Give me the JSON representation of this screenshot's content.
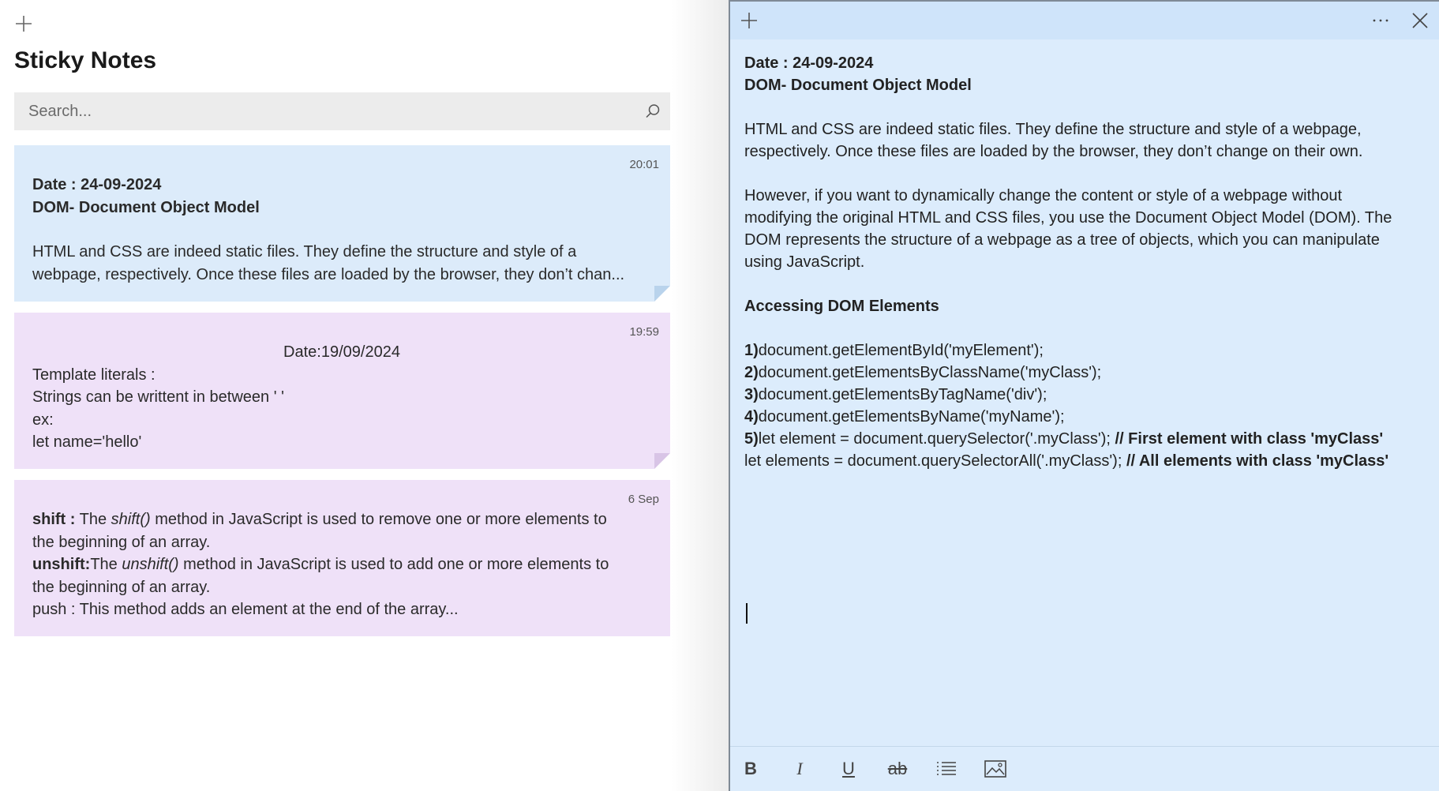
{
  "list": {
    "title": "Sticky Notes",
    "search_placeholder": "Search...",
    "notes": [
      {
        "time": "20:01",
        "line1": "Date : 24-09-2024",
        "line2": "DOM- Document Object Model",
        "line3": "HTML and CSS are indeed static files. They define the structure and style of a",
        "line4": "webpage, respectively. Once these files are loaded by the browser, they don’t chan..."
      },
      {
        "time": "19:59",
        "line1": "Date:19/09/2024",
        "line2": "Template literals :",
        "line3": "Strings can be writtent in between ' '",
        "line4": "ex:",
        "line5": "let name='hello'"
      },
      {
        "time": "6 Sep",
        "l1_bold": "shift :",
        "l1_a": " The ",
        "l1_italic": "shift()",
        "l1_b": " method in JavaScript is used to remove one or more elements to",
        "line2": "the beginning of an array.",
        "l3_bold": "unshift:",
        "l3_a": "The ",
        "l3_italic": "unshift()",
        "l3_b": " method in JavaScript is used to add one or more elements to",
        "line4": "the beginning of an array.",
        "line5": "push : This method adds an element at the end of the array..."
      }
    ]
  },
  "editor": {
    "heading1": "Date : 24-09-2024",
    "heading2": "DOM- Document Object Model",
    "para1_l1": "HTML and CSS are indeed static files. They define the structure and style of a webpage,",
    "para1_l2": "respectively. Once these files are loaded by the browser, they don’t change on their own.",
    "para2_l1": "However, if you want to dynamically change the content or style of a webpage without",
    "para2_l2": "modifying the original HTML and CSS files, you use the Document Object Model (DOM). The",
    "para2_l3": "DOM represents the structure of a webpage as a tree of objects, which you can manipulate",
    "para2_l4": "using JavaScript.",
    "section_heading": "Accessing DOM Elements",
    "items": [
      {
        "num": "1)",
        "code": "document.getElementById('myElement');",
        "comment": ""
      },
      {
        "num": "2)",
        "code": "document.getElementsByClassName('myClass');",
        "comment": ""
      },
      {
        "num": "3)",
        "code": "document.getElementsByTagName('div');",
        "comment": ""
      },
      {
        "num": "4)",
        "code": "document.getElementsByName('myName');",
        "comment": ""
      },
      {
        "num": "5)",
        "code": "let element = document.querySelector('.myClass'); ",
        "comment": "// First element with class 'myClass'"
      },
      {
        "num": "",
        "code": "let elements = document.querySelectorAll('.myClass'); ",
        "comment": "// All elements with class 'myClass'"
      }
    ],
    "toolbar": {
      "bold": "B",
      "italic": "I",
      "underline": "U",
      "strikethrough": "ab"
    }
  },
  "colors": {
    "note_blue": "#dcebfa",
    "note_purple": "#efe1f8",
    "editor_bg": "#dcecfc",
    "titlebar_bg": "#cfe4fa"
  },
  "icons": [
    "plus-icon",
    "search-icon",
    "more-icon",
    "close-icon",
    "bullet-list-icon",
    "image-icon"
  ]
}
